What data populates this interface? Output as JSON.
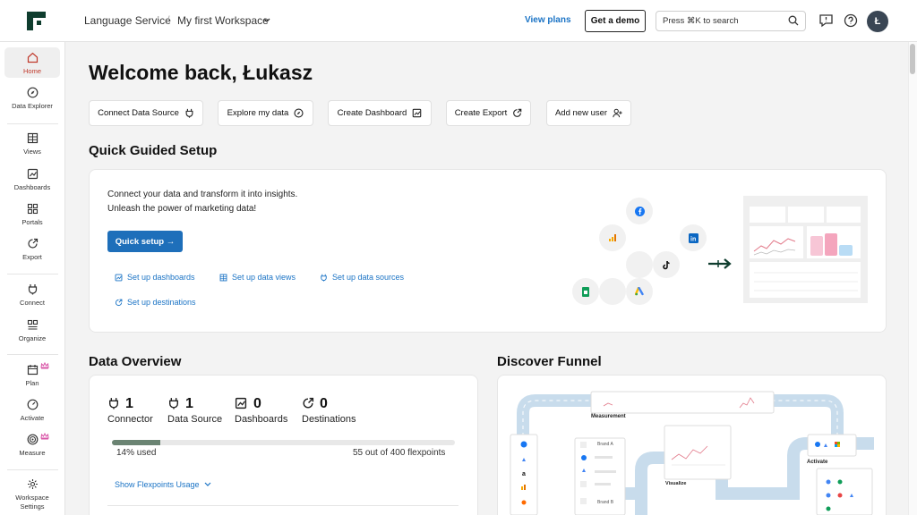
{
  "header": {
    "breadcrumb_service": "Language Service",
    "breadcrumb_workspace": "My first Workspace",
    "view_plans": "View plans",
    "get_demo": "Get a demo",
    "search_placeholder": "Press ⌘K to search",
    "avatar_initial": "Ł"
  },
  "sidebar": {
    "items": [
      {
        "label": "Home",
        "icon": "home-icon"
      },
      {
        "label": "Data Explorer",
        "icon": "compass-icon"
      },
      {
        "label": "Views",
        "icon": "table-icon"
      },
      {
        "label": "Dashboards",
        "icon": "chart-icon"
      },
      {
        "label": "Portals",
        "icon": "grid-icon"
      },
      {
        "label": "Export",
        "icon": "export-icon"
      },
      {
        "label": "Connect",
        "icon": "plug-icon"
      },
      {
        "label": "Organize",
        "icon": "organize-icon"
      },
      {
        "label": "Plan",
        "icon": "calendar-icon"
      },
      {
        "label": "Activate",
        "icon": "gauge-icon"
      },
      {
        "label": "Measure",
        "icon": "target-icon"
      },
      {
        "label": "Workspace Settings",
        "icon": "gear-icon"
      }
    ]
  },
  "main": {
    "welcome": "Welcome back, Łukasz",
    "quick_actions": [
      {
        "label": "Connect Data Source",
        "icon": "plug-icon"
      },
      {
        "label": "Explore my data",
        "icon": "compass-icon"
      },
      {
        "label": "Create Dashboard",
        "icon": "chart-icon"
      },
      {
        "label": "Create Export",
        "icon": "export-icon"
      },
      {
        "label": "Add new user",
        "icon": "add-user-icon"
      }
    ],
    "guided_setup": {
      "title": "Quick Guided Setup",
      "line1": "Connect your data and transform it into insights.",
      "line2": "Unleash the power of marketing data!",
      "button": "Quick setup →",
      "links": [
        "Set up dashboards",
        "Set up data views",
        "Set up data sources",
        "Set up destinations"
      ]
    },
    "data_overview": {
      "title": "Data Overview",
      "stats": [
        {
          "value": "1",
          "label": "Connector"
        },
        {
          "value": "1",
          "label": "Data Source"
        },
        {
          "value": "0",
          "label": "Dashboards"
        },
        {
          "value": "0",
          "label": "Destinations"
        }
      ],
      "usage_fraction": 0.14,
      "usage_percent_text": "14% used",
      "flexpoints_text": "55 out of 400 flexpoints",
      "show_usage": "Show Flexpoints Usage"
    },
    "funnel": {
      "title": "Discover Funnel",
      "measurement": "Measurement",
      "brand_a": "Brand A",
      "brand_b": "Brand B",
      "visualize": "Visualize",
      "activate": "Activate"
    }
  },
  "colors": {
    "accent": "#1e6fba",
    "brand": "#0f3d2e",
    "progress": "#6b8473",
    "active_nav": "#c0392b"
  }
}
